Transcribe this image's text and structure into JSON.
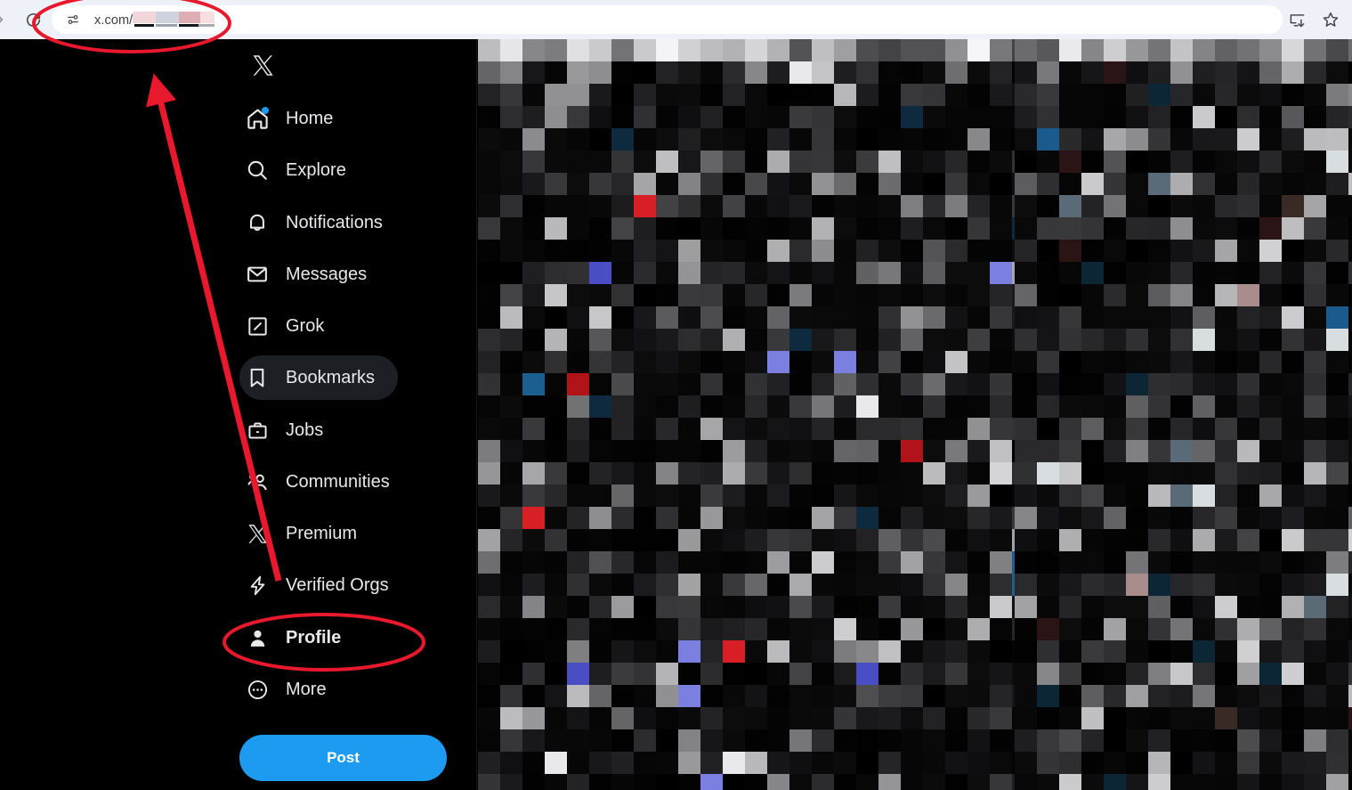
{
  "browser": {
    "url_prefix": "x.com/",
    "url_redacted": true,
    "forward_icon": "forward-arrow-icon",
    "reload_icon": "reload-icon",
    "site_info_icon": "site-settings-icon",
    "actions": [
      {
        "name": "install-app-icon",
        "label": "Install"
      },
      {
        "name": "bookmark-star-icon",
        "label": "Bookmark this tab"
      }
    ]
  },
  "sidebar": {
    "logo_label": "X",
    "items": [
      {
        "label": "Home",
        "icon": "home-icon",
        "badge": true,
        "active": false,
        "bold": false
      },
      {
        "label": "Explore",
        "icon": "search-icon",
        "badge": false,
        "active": false,
        "bold": false
      },
      {
        "label": "Notifications",
        "icon": "bell-icon",
        "badge": false,
        "active": false,
        "bold": false
      },
      {
        "label": "Messages",
        "icon": "envelope-icon",
        "badge": false,
        "active": false,
        "bold": false
      },
      {
        "label": "Grok",
        "icon": "grok-icon",
        "badge": false,
        "active": false,
        "bold": false
      },
      {
        "label": "Bookmarks",
        "icon": "bookmark-icon",
        "badge": false,
        "active": true,
        "bold": false
      },
      {
        "label": "Jobs",
        "icon": "briefcase-icon",
        "badge": false,
        "active": false,
        "bold": false
      },
      {
        "label": "Communities",
        "icon": "communities-icon",
        "badge": false,
        "active": false,
        "bold": false
      },
      {
        "label": "Premium",
        "icon": "x-icon",
        "badge": false,
        "active": false,
        "bold": false
      },
      {
        "label": "Verified Orgs",
        "icon": "lightning-icon",
        "badge": false,
        "active": false,
        "bold": false
      },
      {
        "label": "Profile",
        "icon": "person-icon",
        "badge": false,
        "active": false,
        "bold": true
      },
      {
        "label": "More",
        "icon": "more-circle-icon",
        "badge": false,
        "active": false,
        "bold": false
      }
    ],
    "post_button_label": "Post"
  },
  "content": {
    "center_column_redacted": true,
    "right_column_redacted": true
  },
  "annotations": {
    "accent_color": "#e8192c",
    "url_ellipse": {
      "label": "highlight around address bar"
    },
    "profile_ellipse": {
      "label": "highlight around Profile nav item"
    },
    "arrow": {
      "label": "arrow from Profile up to address bar"
    }
  },
  "colors": {
    "brand_blue": "#1d9bf0",
    "page_background": "#000000",
    "chrome_background": "#eef1f8",
    "active_pill": "#1c1f23",
    "text_primary": "#e7e9ea",
    "annotation_red": "#e8192c"
  }
}
